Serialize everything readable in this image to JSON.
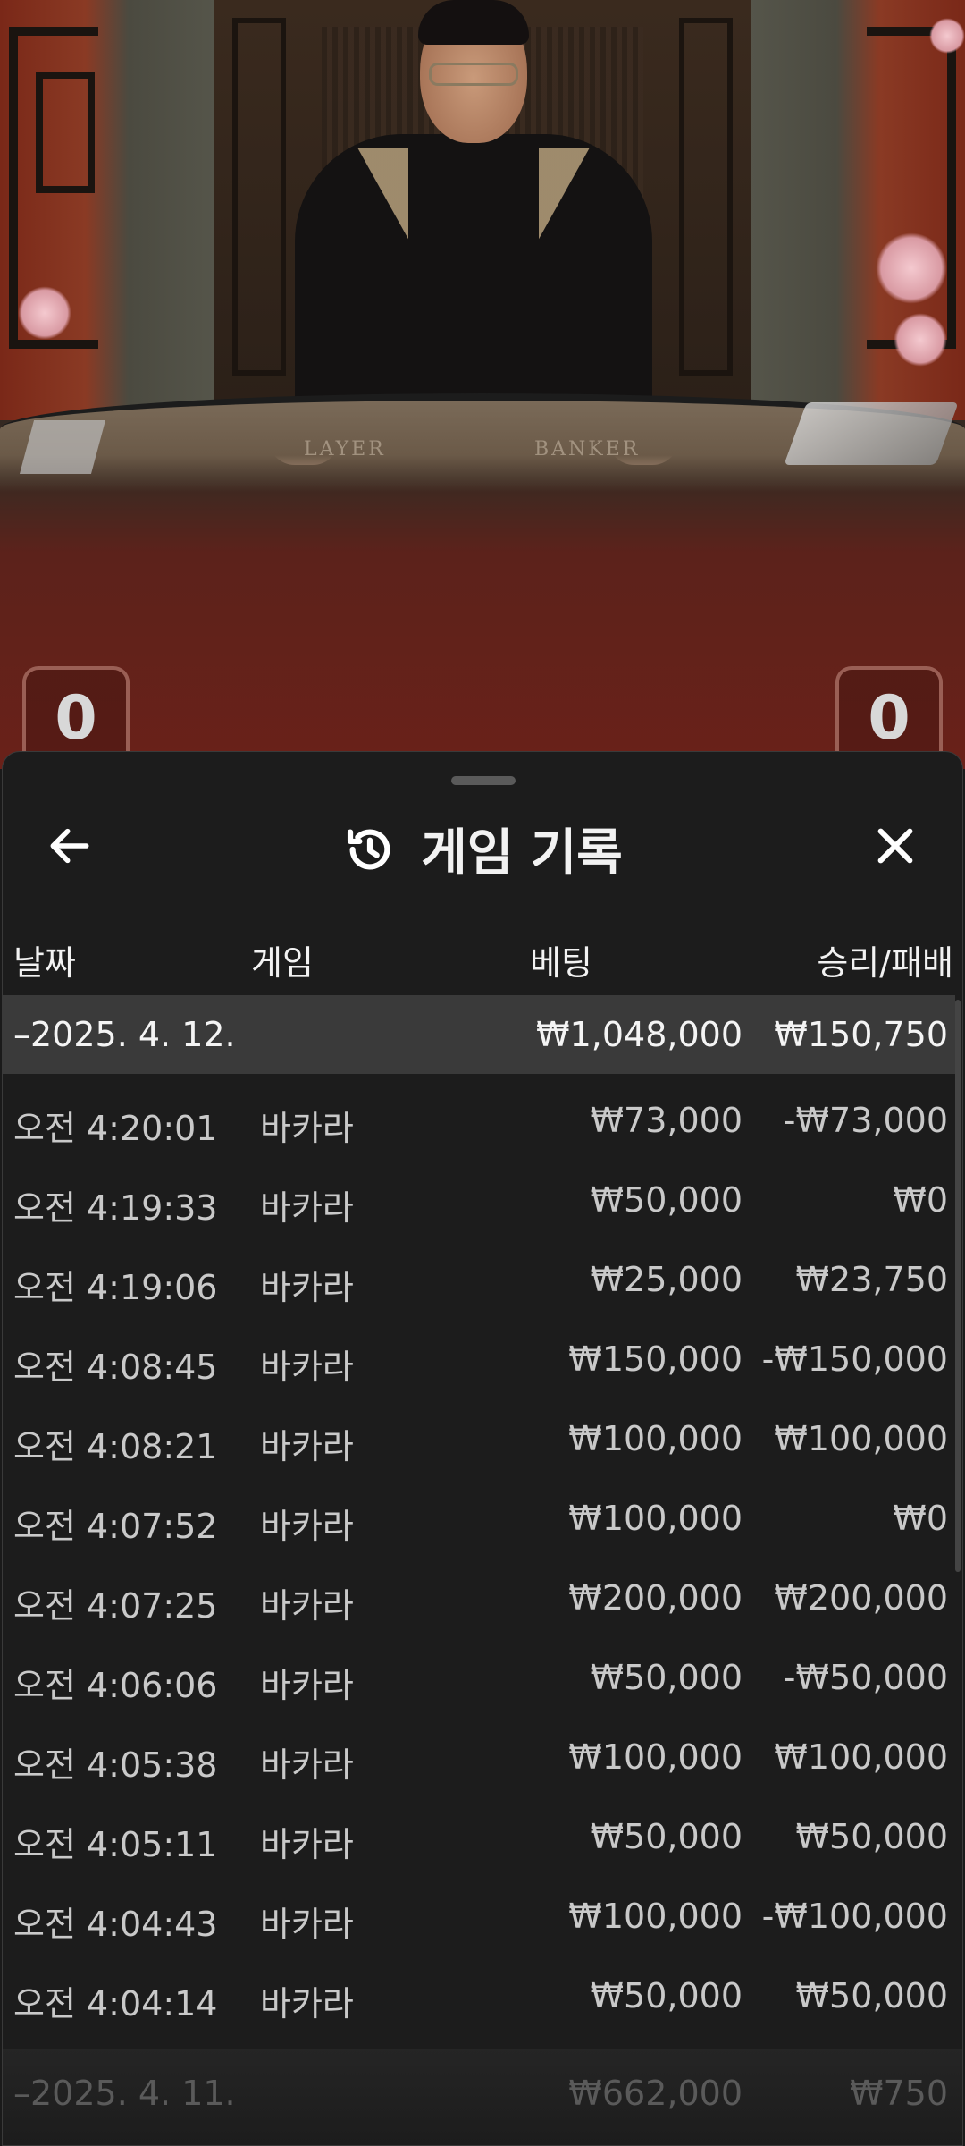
{
  "stage": {
    "table_labels": [
      "LAYER",
      "BANKER"
    ],
    "score_left": "0",
    "score_right": "0"
  },
  "sheet": {
    "title": "게임 기록",
    "icons": {
      "back": "arrow-left-icon",
      "history": "history-icon",
      "close": "close-icon"
    }
  },
  "columns": {
    "date": "날짜",
    "game": "게임",
    "bet": "베팅",
    "win_loss": "승리/패배"
  },
  "day1": {
    "date": "–2025. 4. 12.",
    "bet": "₩1,048,000",
    "win_loss": "₩150,750",
    "entries": [
      {
        "time": "오전 4:20:01",
        "game": "바카라",
        "bet": "₩73,000",
        "win_loss": "-₩73,000"
      },
      {
        "time": "오전 4:19:33",
        "game": "바카라",
        "bet": "₩50,000",
        "win_loss": "₩0"
      },
      {
        "time": "오전 4:19:06",
        "game": "바카라",
        "bet": "₩25,000",
        "win_loss": "₩23,750"
      },
      {
        "time": "오전 4:08:45",
        "game": "바카라",
        "bet": "₩150,000",
        "win_loss": "-₩150,000"
      },
      {
        "time": "오전 4:08:21",
        "game": "바카라",
        "bet": "₩100,000",
        "win_loss": "₩100,000"
      },
      {
        "time": "오전 4:07:52",
        "game": "바카라",
        "bet": "₩100,000",
        "win_loss": "₩0"
      },
      {
        "time": "오전 4:07:25",
        "game": "바카라",
        "bet": "₩200,000",
        "win_loss": "₩200,000"
      },
      {
        "time": "오전 4:06:06",
        "game": "바카라",
        "bet": "₩50,000",
        "win_loss": "-₩50,000"
      },
      {
        "time": "오전 4:05:38",
        "game": "바카라",
        "bet": "₩100,000",
        "win_loss": "₩100,000"
      },
      {
        "time": "오전 4:05:11",
        "game": "바카라",
        "bet": "₩50,000",
        "win_loss": "₩50,000"
      },
      {
        "time": "오전 4:04:43",
        "game": "바카라",
        "bet": "₩100,000",
        "win_loss": "-₩100,000"
      },
      {
        "time": "오전 4:04:14",
        "game": "바카라",
        "bet": "₩50,000",
        "win_loss": "₩50,000"
      }
    ]
  },
  "day2": {
    "date": "–2025. 4. 11.",
    "bet": "₩662,000",
    "win_loss": "₩750"
  }
}
